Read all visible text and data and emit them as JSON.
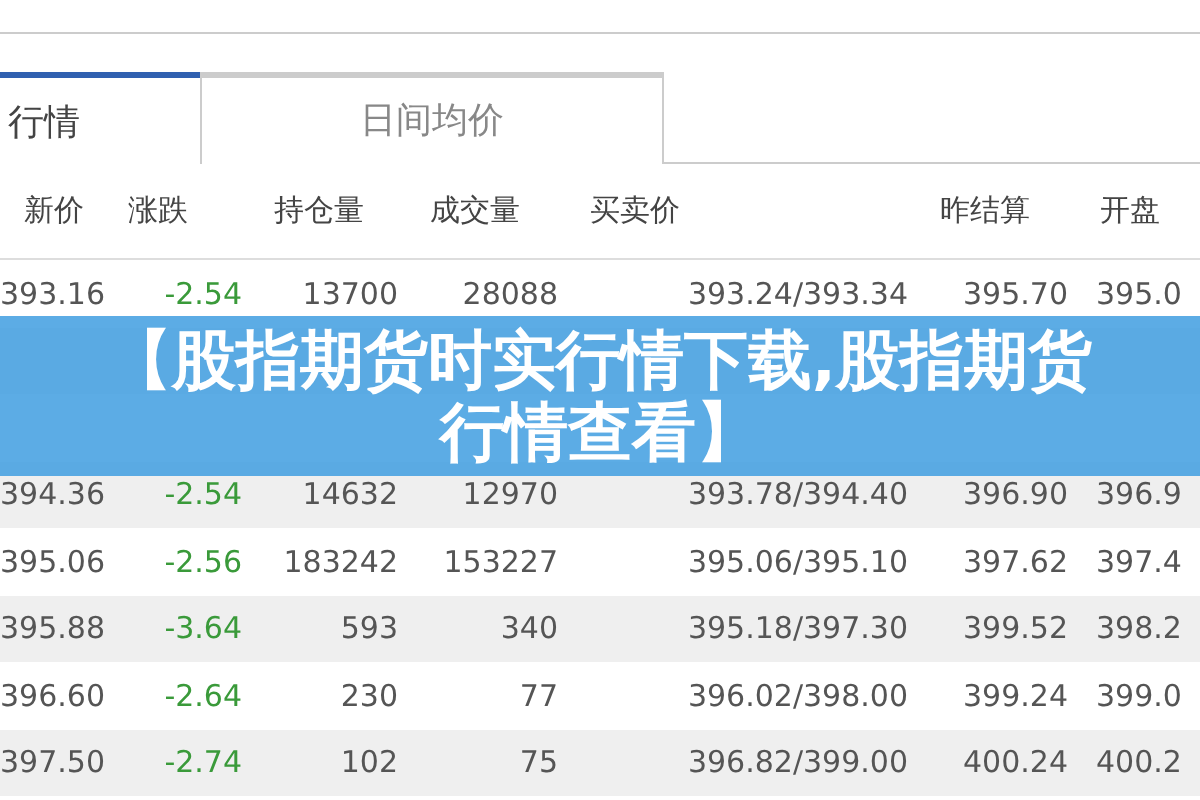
{
  "tabs": [
    {
      "label": "行情",
      "selected": true
    },
    {
      "label": "日间均价",
      "selected": false
    }
  ],
  "table": {
    "columns": [
      "新价",
      "涨跌",
      "持仓量",
      "成交量",
      "买卖价",
      "昨结算",
      "开盘"
    ],
    "rows": [
      [
        "393.16",
        "-2.54",
        "13700",
        "28088",
        "393.24/393.34",
        "395.70",
        "395.0"
      ],
      [
        null,
        null,
        null,
        null,
        null,
        null,
        null
      ],
      [
        null,
        null,
        null,
        null,
        null,
        null,
        null
      ],
      [
        "394.36",
        "-2.54",
        "14632",
        "12970",
        "393.78/394.40",
        "396.90",
        "396.9"
      ],
      [
        "395.06",
        "-2.56",
        "183242",
        "153227",
        "395.06/395.10",
        "397.62",
        "397.4"
      ],
      [
        "395.88",
        "-3.64",
        "593",
        "340",
        "395.18/397.30",
        "399.52",
        "398.2"
      ],
      [
        "396.60",
        "-2.64",
        "230",
        "77",
        "396.02/398.00",
        "399.24",
        "399.0"
      ],
      [
        "397.50",
        "-2.74",
        "102",
        "75",
        "396.82/399.00",
        "400.24",
        "400.2"
      ]
    ]
  },
  "banner": {
    "text": "【股指期货时实行情下载,股指期货行情查看】"
  }
}
